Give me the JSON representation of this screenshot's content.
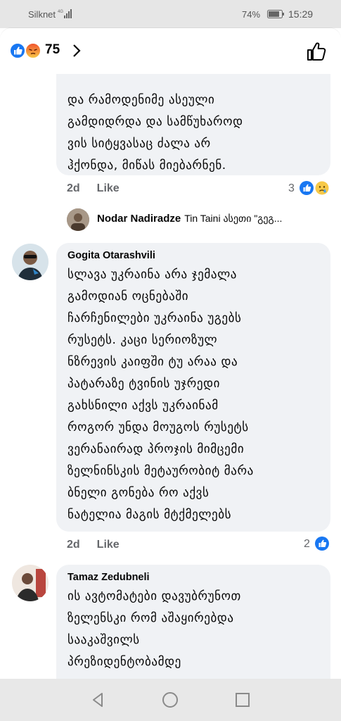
{
  "status_bar": {
    "carrier": "Silknet",
    "battery": "74%",
    "time": "15:29"
  },
  "reactions_header": {
    "count": "75",
    "icons": [
      "like-icon",
      "angry-icon"
    ]
  },
  "comments": [
    {
      "author": "",
      "text": "ᲓᲐ ᲠᲐᲛᲝᲓᲔᲜᲘᲛᲔ ᲐᲡᲔᲣᲚᲘ ᲒᲐᲛᲓᲘᲓᲠᲓᲐ ᲓᲐ ᲡᲐᲛᲬᲣᲮᲐᲠᲝᲓ ᲕᲘᲡ ᲡᲘᲢᲧᲕᲐᲡᲐᲪ ᲫᲐᲚᲐ ᲐᲠ ᲰᲥᲝᲜᲓᲐ, ᲛᲘᲬᲐᲡ ᲛᲘᲔᲑᲐᲠᲜᲔᲜ.",
      "lines": [
        "და რამოდენიმე ასეული",
        "გამდიდრდა და სამწუხაროდ",
        "ვის სიტყვასაც ძალა არ",
        "ჰქონდა, მიწას მიებარნენ."
      ],
      "time": "2d",
      "like_label": "Like",
      "reaction_count": "3",
      "reaction_icons": [
        "like-icon",
        "sad-icon"
      ]
    },
    {
      "author": "Gogita Otarashvili",
      "lines": [
        "სლავა უკრაინა არა ჯემალა",
        "გამოდიან ოცნებაში",
        "ჩარჩენილები უკრაინა უგებს",
        "რუსეტს. კაცი სერიოზულ",
        "ნზრევის კაიფში ტუ არაა და",
        "პატარაზე ტვინის უჯრედი",
        "გახსნილი აქვს უკრაინამ",
        "როგორ უნდა მოუგოს რუსეტს",
        "ვერანაირად პროჯის მიმცემი",
        "ზელნინსკის მეტაურობიტ მარა",
        "ბნელი გონება რო აქვს",
        "ნატელია მაგის მტქმელებს"
      ],
      "time": "2d",
      "like_label": "Like",
      "reaction_count": "2",
      "reaction_icons": [
        "like-icon"
      ]
    },
    {
      "author": "Tamaz Zedubneli",
      "lines": [
        "ის ავტომატები დავუბრუნოთ",
        "ზელენსკი რომ აშაყირებდა",
        "სააკაშვილს",
        "პრეზიდენტობამდე"
      ]
    }
  ],
  "reply_preview": {
    "author": "Nodar Nadiradze",
    "text": "Tin Taini ასეთი \"გეგ..."
  }
}
